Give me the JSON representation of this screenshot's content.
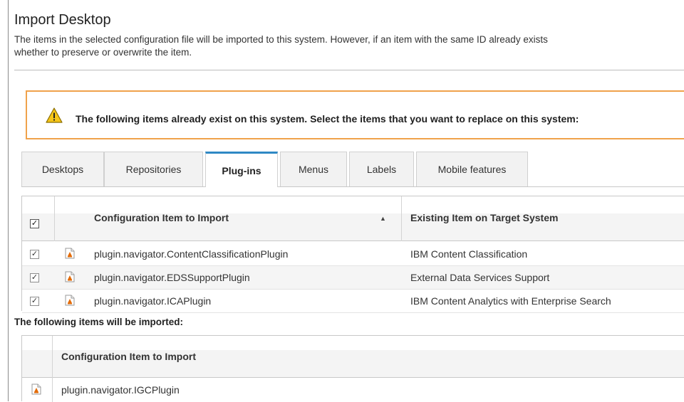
{
  "page": {
    "title": "Import Desktop",
    "description_line1": "The items in the selected configuration file will be imported to this system. However, if an item with the same ID already exists",
    "description_line2": "whether to preserve or overwrite the item."
  },
  "warning": {
    "icon": "warning-triangle-icon",
    "text": "The following items already exist on this system. Select the items that you want to replace on this system:"
  },
  "tabs": [
    {
      "label": "Desktops",
      "active": false
    },
    {
      "label": "Repositories",
      "active": false
    },
    {
      "label": "Plug-ins",
      "active": true
    },
    {
      "label": "Menus",
      "active": false
    },
    {
      "label": "Labels",
      "active": false
    },
    {
      "label": "Mobile features",
      "active": false
    }
  ],
  "existing_table": {
    "col_import": "Configuration Item to Import",
    "col_existing": "Existing Item on Target System",
    "sort_indicator": "▲",
    "header_checked": true,
    "rows": [
      {
        "checked": true,
        "import_item": "plugin.navigator.ContentClassificationPlugin",
        "existing_item": "IBM Content Classification"
      },
      {
        "checked": true,
        "import_item": "plugin.navigator.EDSSupportPlugin",
        "existing_item": "External Data Services Support"
      },
      {
        "checked": true,
        "import_item": "plugin.navigator.ICAPlugin",
        "existing_item": "IBM Content Analytics with Enterprise Search"
      }
    ]
  },
  "import_section": {
    "label": "The following items will be imported:",
    "col_import": "Configuration Item to Import",
    "rows": [
      {
        "import_item": "plugin.navigator.IGCPlugin"
      }
    ]
  },
  "colors": {
    "warning_border": "#f0a24b",
    "active_tab_accent": "#2e88c4",
    "warning_icon_fill": "#f5c518",
    "plugin_icon_orange": "#e36c0a"
  }
}
